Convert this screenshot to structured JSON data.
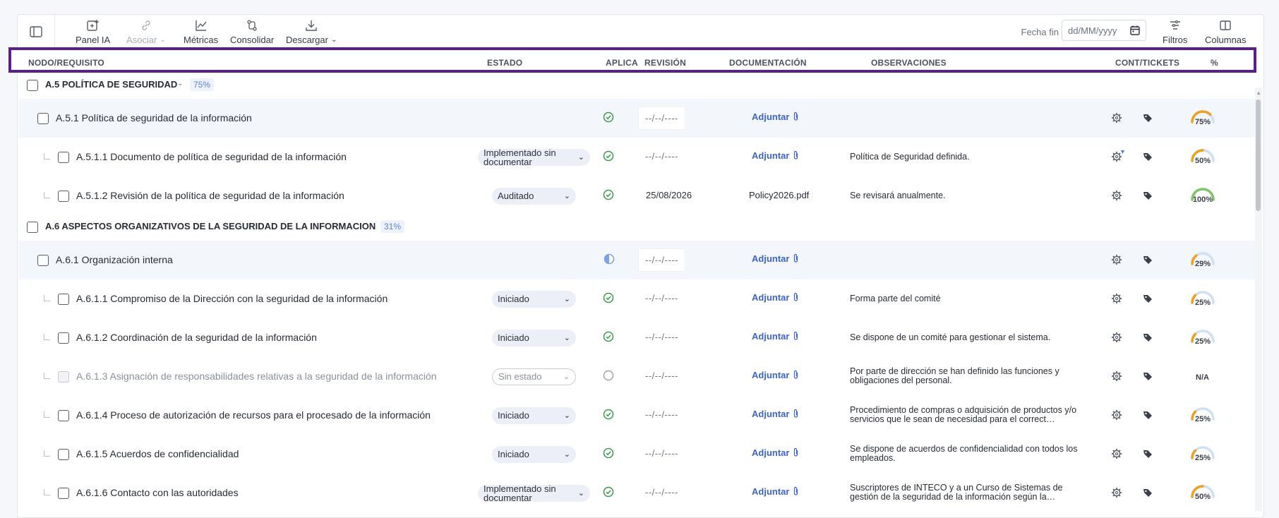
{
  "toolbar": {
    "panel_ia": "Panel IA",
    "asociar": "Asociar",
    "metricas": "Métricas",
    "consolidar": "Consolidar",
    "descargar": "Descargar",
    "fecha_fin_label": "Fecha fin",
    "fecha_fin_placeholder": "dd/MM/yyyy",
    "filtros": "Filtros",
    "columnas": "Columnas"
  },
  "columns": {
    "nodo": "NODO/REQUISITO",
    "estado": "ESTADO",
    "aplica": "APLICA",
    "revision": "REVISIÓN",
    "documentacion": "DOCUMENTACIÓN",
    "observaciones": "OBSERVACIONES",
    "cont_tickets": "CONT/TICKETS",
    "pct": "%"
  },
  "colors": {
    "accent": "#3d64c6",
    "highlight_border": "#5b1f8a",
    "check_green": "#3a9a4a",
    "gauge_orange": "#f0a020",
    "gauge_green": "#7ec46a",
    "gauge_track": "#cfe0f3"
  },
  "rows": [
    {
      "kind": "group",
      "code_name": "A.5 POLÍTICA DE SEGURIDAD",
      "pct": "75%"
    },
    {
      "kind": "node",
      "code_name": "A.5.1 Política de seguridad de la información",
      "aplica": "check",
      "revision": "--/--/----",
      "doc": "Adjuntar",
      "obs": "",
      "gauge": "75%",
      "gauge_value": 75
    },
    {
      "kind": "req",
      "code_name": "A.5.1.1 Documento de política de seguridad de la información",
      "estado": "Implementado sin documentar",
      "aplica": "check",
      "revision": "--/--/----",
      "doc": "Adjuntar",
      "obs": "Política de Seguridad definida.",
      "gauge": "50%",
      "gauge_value": 50,
      "flag": true
    },
    {
      "kind": "req",
      "code_name": "A.5.1.2 Revisión de la política de seguridad de la información",
      "estado": "Auditado",
      "aplica": "check",
      "revision": "25/08/2026",
      "doc": "Policy2026.pdf",
      "obs": "Se revisará anualmente.",
      "gauge": "100%",
      "gauge_value": 100
    },
    {
      "kind": "group",
      "code_name": "A.6 ASPECTOS ORGANIZATIVOS DE LA SEGURIDAD DE LA INFORMACION",
      "pct": "31%"
    },
    {
      "kind": "node",
      "code_name": "A.6.1 Organización interna",
      "aplica": "half",
      "revision": "--/--/----",
      "doc": "Adjuntar",
      "obs": "",
      "gauge": "29%",
      "gauge_value": 29
    },
    {
      "kind": "req",
      "code_name": "A.6.1.1 Compromiso de la Dirección con la seguridad de la información",
      "estado": "Iniciado",
      "aplica": "check",
      "revision": "--/--/----",
      "doc": "Adjuntar",
      "obs": "Forma parte del comité",
      "gauge": "25%",
      "gauge_value": 25
    },
    {
      "kind": "req",
      "code_name": "A.6.1.2 Coordinación de la seguridad de la información",
      "estado": "Iniciado",
      "aplica": "check",
      "revision": "--/--/----",
      "doc": "Adjuntar",
      "obs": "Se dispone de un comité para gestionar el sistema.",
      "gauge": "25%",
      "gauge_value": 25
    },
    {
      "kind": "req",
      "code_name": "A.6.1.3 Asignación de responsabilidades relativas a la seguridad de la información",
      "estado": "Sin estado",
      "aplica": "empty",
      "revision": "--/--/----",
      "doc": "Adjuntar",
      "obs": "Por parte de dirección se han definido las funciones y obligaciones del personal.",
      "gauge": "N/A",
      "disabled": true
    },
    {
      "kind": "req",
      "code_name": "A.6.1.4 Proceso de autorización de recursos para el procesado de la información",
      "estado": "Iniciado",
      "aplica": "check",
      "revision": "--/--/----",
      "doc": "Adjuntar",
      "obs": "Procedimiento de compras o adquisición de productos y/o servicios que le sean de necesidad para el correct…",
      "gauge": "25%",
      "gauge_value": 25
    },
    {
      "kind": "req",
      "code_name": "A.6.1.5 Acuerdos de confidencialidad",
      "estado": "Iniciado",
      "aplica": "check",
      "revision": "--/--/----",
      "doc": "Adjuntar",
      "obs": "Se dispone de acuerdos de confidencialidad con todos los empleados.",
      "gauge": "25%",
      "gauge_value": 25
    },
    {
      "kind": "req",
      "code_name": "A.6.1.6 Contacto con las autoridades",
      "estado": "Implementado sin documentar",
      "aplica": "check",
      "revision": "--/--/----",
      "doc": "Adjuntar",
      "obs": "Suscriptores de INTECO y a un Curso de Sistemas de gestión de la seguridad de la información según la…",
      "gauge": "50%",
      "gauge_value": 50
    }
  ]
}
